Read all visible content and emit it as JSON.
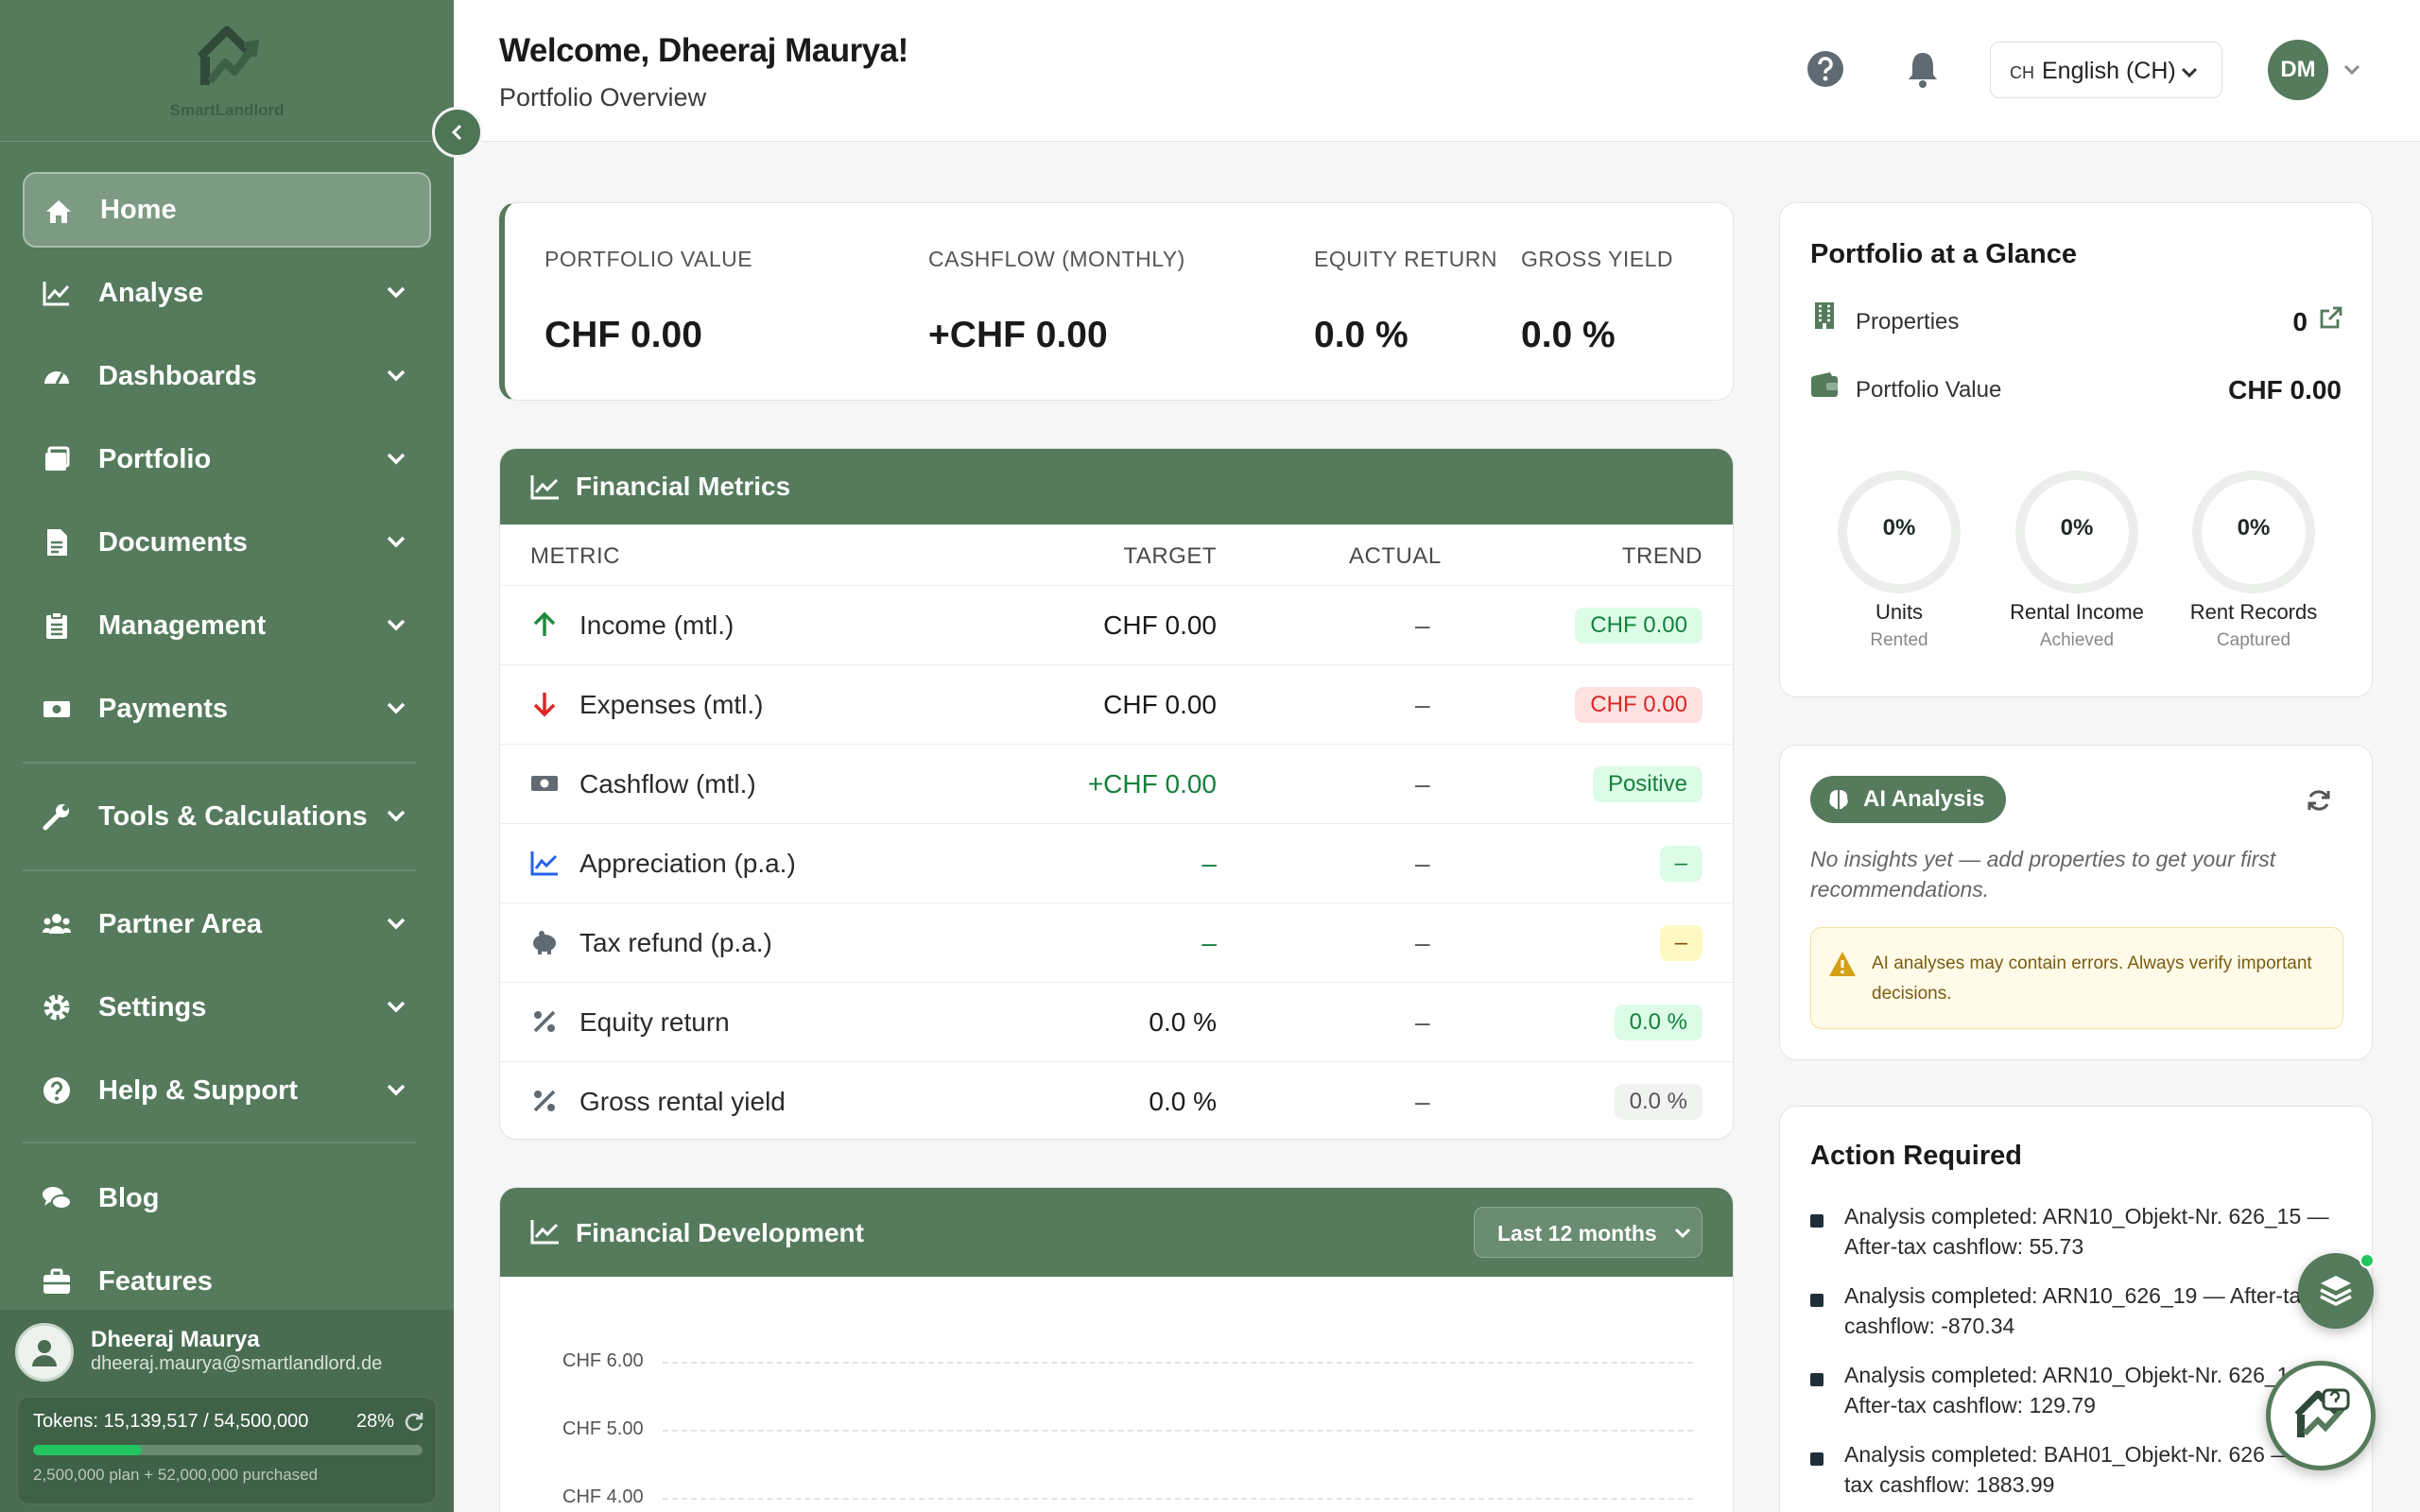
{
  "app": {
    "name": "SmartLandlord"
  },
  "header": {
    "welcome": "Welcome, Dheeraj Maurya!",
    "subtitle": "Portfolio Overview",
    "language_code": "CH",
    "language_label": "English (CH)",
    "avatar_initials": "DM"
  },
  "sidebar": {
    "items": [
      {
        "label": "Home",
        "icon": "home-icon",
        "active": true
      },
      {
        "label": "Analyse",
        "icon": "chart-line-icon"
      },
      {
        "label": "Dashboards",
        "icon": "gauge-icon"
      },
      {
        "label": "Portfolio",
        "icon": "portfolio-icon"
      },
      {
        "label": "Documents",
        "icon": "document-icon"
      },
      {
        "label": "Management",
        "icon": "clipboard-icon"
      },
      {
        "label": "Payments",
        "icon": "money-icon"
      },
      {
        "label": "Tools & Calculations",
        "icon": "wrench-icon"
      },
      {
        "label": "Partner Area",
        "icon": "users-icon"
      },
      {
        "label": "Settings",
        "icon": "gear-icon"
      },
      {
        "label": "Help & Support",
        "icon": "question-icon"
      },
      {
        "label": "Blog",
        "icon": "comments-icon"
      },
      {
        "label": "Features",
        "icon": "briefcase-icon"
      }
    ],
    "user": {
      "name": "Dheeraj Maurya",
      "email": "dheeraj.maurya@smartlandlord.de",
      "tokens_label": "Tokens: 15,139,517 / 54,500,000",
      "tokens_percent_label": "28%",
      "tokens_fraction": 0.28,
      "tokens_detail": "2,500,000 plan + 52,000,000 purchased"
    }
  },
  "stats": [
    {
      "key": "PORTFOLIO VALUE",
      "value": "CHF 0.00"
    },
    {
      "key": "CASHFLOW (MONTHLY)",
      "value": "+CHF 0.00"
    },
    {
      "key": "EQUITY RETURN",
      "value": "0.0 %"
    },
    {
      "key": "GROSS YIELD",
      "value": "0.0 %"
    }
  ],
  "metrics": {
    "title": "Financial Metrics",
    "columns": {
      "metric": "METRIC",
      "target": "TARGET",
      "actual": "ACTUAL",
      "trend": "TREND"
    },
    "rows": [
      {
        "label": "Income (mtl.)",
        "target": "CHF 0.00",
        "actual": "–",
        "trend": "CHF 0.00",
        "icon": "arrow-up-icon"
      },
      {
        "label": "Expenses (mtl.)",
        "target": "CHF 0.00",
        "actual": "–",
        "trend": "CHF 0.00",
        "icon": "arrow-down-icon"
      },
      {
        "label": "Cashflow (mtl.)",
        "target": "+CHF 0.00",
        "actual": "–",
        "trend": "Positive",
        "icon": "money-bill-icon"
      },
      {
        "label": "Appreciation (p.a.)",
        "target": "–",
        "actual": "–",
        "trend": "–",
        "icon": "chart-line-icon"
      },
      {
        "label": "Tax refund (p.a.)",
        "target": "–",
        "actual": "–",
        "trend": "–",
        "icon": "piggy-bank-icon"
      },
      {
        "label": "Equity return",
        "target": "0.0 %",
        "actual": "–",
        "trend": "0.0 %",
        "icon": "percent-icon"
      },
      {
        "label": "Gross rental yield",
        "target": "0.0 %",
        "actual": "–",
        "trend": "0.0 %",
        "icon": "percent-icon"
      }
    ]
  },
  "development": {
    "title": "Financial Development",
    "period": "Last 12 months",
    "y_ticks": [
      "CHF 6.00",
      "CHF 5.00",
      "CHF 4.00"
    ]
  },
  "glance": {
    "title": "Portfolio at a Glance",
    "properties_label": "Properties",
    "properties_value": "0",
    "value_label": "Portfolio Value",
    "value_value": "CHF 0.00",
    "rings": [
      {
        "percent": "0%",
        "label": "Units",
        "sub": "Rented"
      },
      {
        "percent": "0%",
        "label": "Rental Income",
        "sub": "Achieved"
      },
      {
        "percent": "0%",
        "label": "Rent Records",
        "sub": "Captured"
      }
    ]
  },
  "ai": {
    "badge": "AI Analysis",
    "message": "No insights yet — add properties to get your first recommendations.",
    "warning": "AI analyses may contain errors. Always verify important decisions."
  },
  "actions": {
    "title": "Action Required",
    "items": [
      "Analysis completed: ARN10_Objekt-Nr. 626_15 — After-tax cashflow: 55.73",
      "Analysis completed: ARN10_626_19 — After-tax cashflow: -870.34",
      "Analysis completed: ARN10_Objekt-Nr. 626_1 — After-tax cashflow: 129.79",
      "Analysis completed: BAH01_Objekt-Nr. 626 — After-tax cashflow: 1883.99"
    ]
  },
  "colors": {
    "brand": "#557b5c",
    "positive": "#1f8a3c",
    "negative": "#dc2626",
    "warning": "#d4a017"
  }
}
